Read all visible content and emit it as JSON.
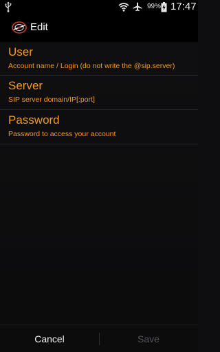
{
  "status_bar": {
    "battery_percent": "99%",
    "time": "17:47",
    "icons": [
      "usb-icon",
      "wifi-icon",
      "airplane-mode-icon",
      "battery-charging-icon"
    ]
  },
  "action_bar": {
    "title": "Edit",
    "logo_icon": "app-logo-icon"
  },
  "preferences": [
    {
      "title": "User",
      "summary": "Account name / Login (do not write the @sip.server)"
    },
    {
      "title": "Server",
      "summary": "SIP server domain/IP[:port]"
    },
    {
      "title": "Password",
      "summary": "Password to access your account"
    }
  ],
  "buttons": {
    "cancel_label": "Cancel",
    "save_label": "Save",
    "save_enabled": false
  },
  "colors": {
    "accent_orange": "#f39a24",
    "background": "#0e0e10",
    "disabled_text": "#55555a"
  }
}
